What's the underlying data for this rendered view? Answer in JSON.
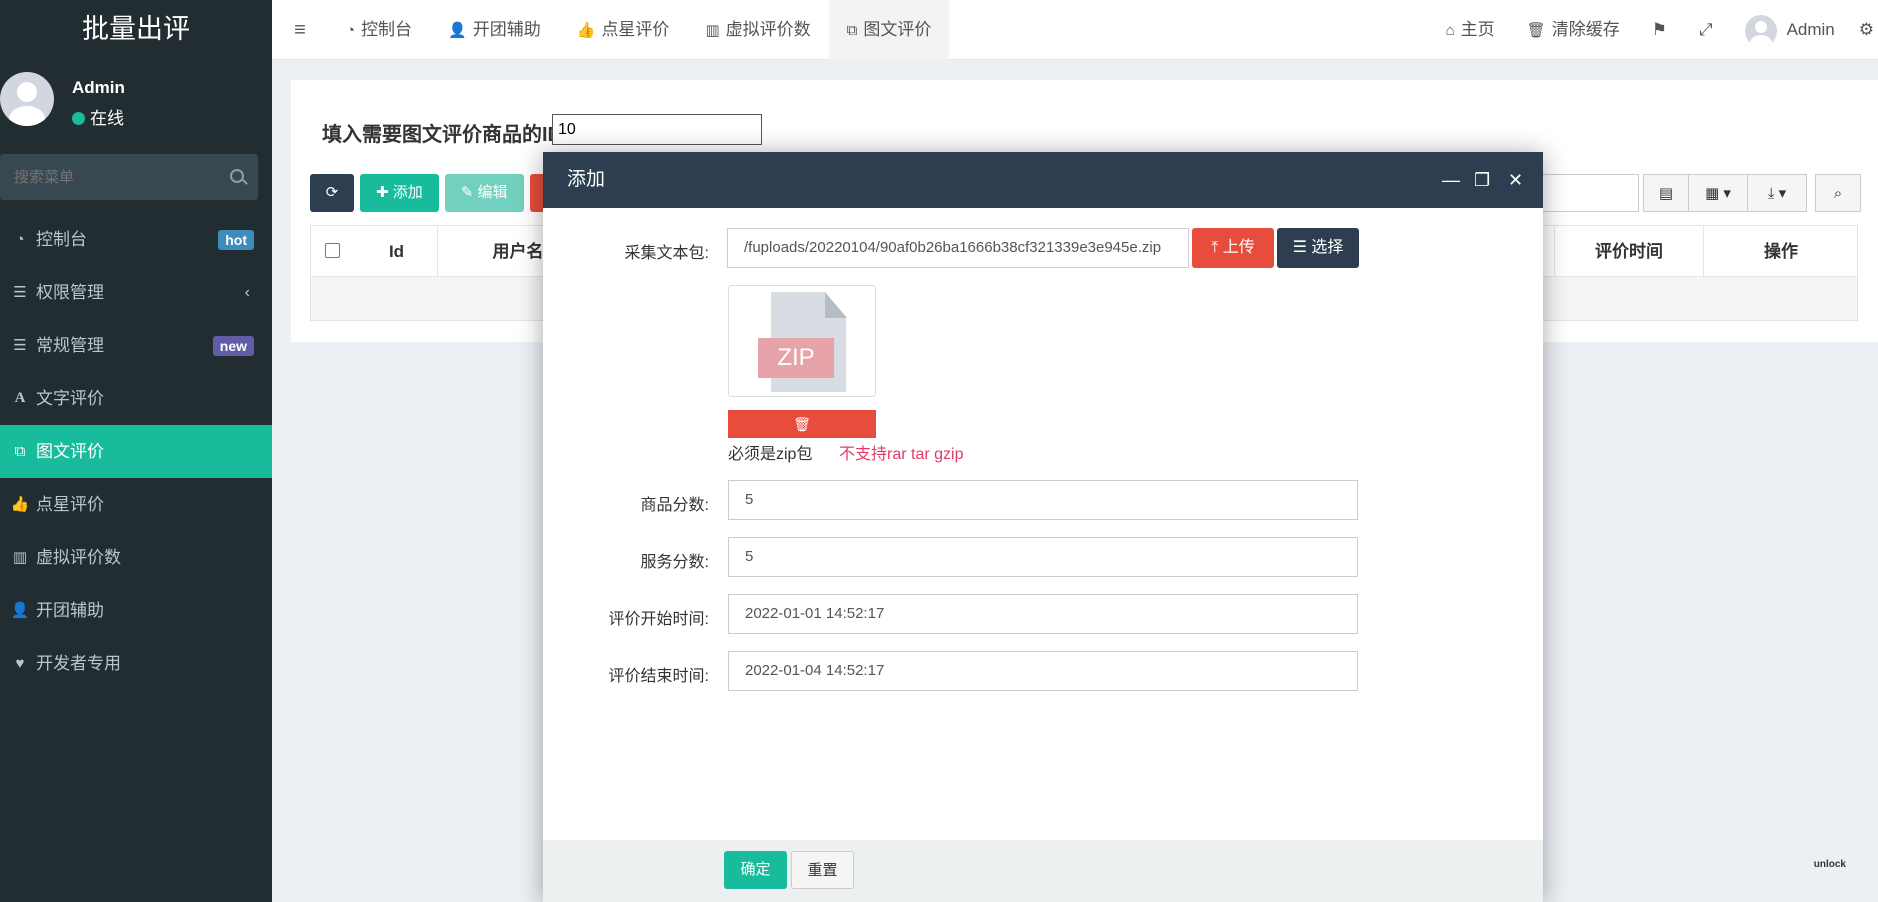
{
  "sidebar": {
    "logo": "批量出评",
    "user": {
      "name": "Admin",
      "status": "在线"
    },
    "search_placeholder": "搜索菜单",
    "items": [
      {
        "label": "控制台",
        "icon": "dashboard-icon",
        "badge": "hot"
      },
      {
        "label": "权限管理",
        "icon": "list-icon",
        "arrow": "‹"
      },
      {
        "label": "常规管理",
        "icon": "list-icon",
        "badge": "new"
      },
      {
        "label": "文字评价",
        "icon": "font-icon"
      },
      {
        "label": "图文评价",
        "icon": "clone-icon",
        "active": true
      },
      {
        "label": "点星评价",
        "icon": "thumbs-up-icon"
      },
      {
        "label": "虚拟评价数",
        "icon": "bar-chart-icon"
      },
      {
        "label": "开团辅助",
        "icon": "user-plus-icon"
      },
      {
        "label": "开发者专用",
        "icon": "heartbeat-icon"
      }
    ]
  },
  "navbar": {
    "tabs": [
      {
        "label": "控制台",
        "icon": "dashboard-icon"
      },
      {
        "label": "开团辅助",
        "icon": "user-plus-icon"
      },
      {
        "label": "点星评价",
        "icon": "thumbs-up-icon"
      },
      {
        "label": "虚拟评价数",
        "icon": "bar-chart-icon"
      },
      {
        "label": "图文评价",
        "icon": "clone-icon",
        "active": true
      }
    ],
    "home_label": "主页",
    "clear_cache_label": "清除缓存",
    "user_label": "Admin"
  },
  "content": {
    "id_label": "填入需要图文评价商品的ID",
    "id_value": "10",
    "toolbar": {
      "add": "添加",
      "edit": "编辑"
    },
    "table_headers": [
      "Id",
      "用户名",
      "评价时间",
      "操作"
    ]
  },
  "modal": {
    "title": "添加",
    "fields": {
      "package_label": "采集文本包:",
      "package_value": "/fuploads/20220104/90af0b26ba1666b38cf321339e3e945e.zip",
      "upload_label": "上传",
      "choose_label": "选择",
      "zip_badge": "ZIP",
      "hint": "必须是zip包",
      "hint_warning": "不支持rar tar gzip",
      "goods_score_label": "商品分数:",
      "goods_score_value": "5",
      "service_score_label": "服务分数:",
      "service_score_value": "5",
      "start_time_label": "评价开始时间:",
      "start_time_value": "2022-01-01 14:52:17",
      "end_time_label": "评价结束时间:",
      "end_time_value": "2022-01-04 14:52:17"
    },
    "ok_label": "确定",
    "reset_label": "重置"
  },
  "corner_mark": "unlock",
  "colors": {
    "primary": "#18bc9c",
    "dark": "#2c3e50",
    "danger": "#e74c3c",
    "sidebar": "#222d32"
  }
}
